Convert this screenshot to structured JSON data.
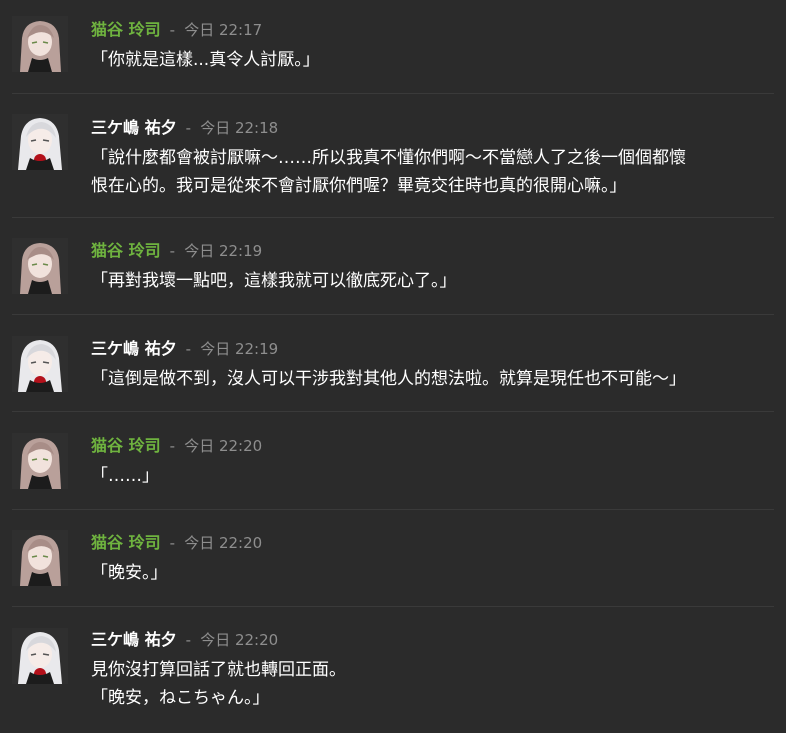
{
  "colors": {
    "background": "#2b2b2b",
    "divider": "#3a3a3a",
    "name_green": "#6fb33f",
    "name_white": "#ffffff",
    "timestamp": "#8e8e8e"
  },
  "messages": [
    {
      "author": "猫谷 玲司",
      "avatar": "nekotani-avatar",
      "sep": "-",
      "time": "今日 22:17",
      "lines": [
        "「你就是這樣...真令人討厭。」"
      ]
    },
    {
      "author": "三ケ嶋 祐夕",
      "avatar": "mikeshima-avatar",
      "sep": "-",
      "time": "今日 22:18",
      "lines": [
        "「說什麼都會被討厭嘛～……所以我真不懂你們啊～不當戀人了之後一個個都懷",
        "恨在心的。我可是從來不會討厭你們喔？畢竟交往時也真的很開心嘛。」"
      ]
    },
    {
      "author": "猫谷 玲司",
      "avatar": "nekotani-avatar",
      "sep": "-",
      "time": "今日 22:19",
      "lines": [
        "「再對我壞一點吧，這樣我就可以徹底死心了。」"
      ]
    },
    {
      "author": "三ケ嶋 祐夕",
      "avatar": "mikeshima-avatar",
      "sep": "-",
      "time": "今日 22:19",
      "lines": [
        "「這倒是做不到，沒人可以干涉我對其他人的想法啦。就算是現任也不可能～」"
      ]
    },
    {
      "author": "猫谷 玲司",
      "avatar": "nekotani-avatar",
      "sep": "-",
      "time": "今日 22:20",
      "lines": [
        "「……」"
      ]
    },
    {
      "author": "猫谷 玲司",
      "avatar": "nekotani-avatar",
      "sep": "-",
      "time": "今日 22:20",
      "lines": [
        "「晚安。」"
      ]
    },
    {
      "author": "三ケ嶋 祐夕",
      "avatar": "mikeshima-avatar",
      "sep": "-",
      "time": "今日 22:20",
      "lines": [
        "見你沒打算回話了就也轉回正面。",
        "「晚安，ねこちゃん。」"
      ]
    }
  ]
}
